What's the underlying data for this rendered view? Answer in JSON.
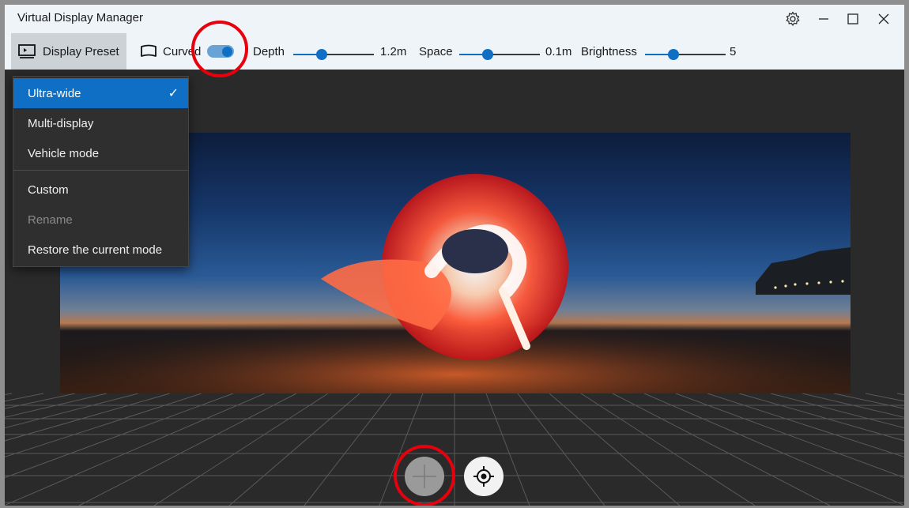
{
  "window": {
    "title": "Virtual Display Manager"
  },
  "titlebar": {
    "buttons": [
      {
        "icon": "gear-icon"
      },
      {
        "icon": "minimize-icon"
      },
      {
        "icon": "maximize-icon"
      },
      {
        "icon": "close-icon"
      }
    ]
  },
  "toolbar": {
    "preset_label": "Display Preset",
    "curved_label": "Curved",
    "curved_on": true,
    "depth_label": "Depth",
    "depth_value": "1.2m",
    "depth_level": 0.35,
    "space_label": "Space",
    "space_value": "0.1m",
    "space_level": 0.35,
    "brightness_label": "Brightness",
    "brightness_value": "5",
    "brightness_level": 0.35
  },
  "menu": {
    "items": [
      {
        "label": "Ultra-wide",
        "selected": true,
        "check": "✓"
      },
      {
        "label": "Multi-display"
      },
      {
        "label": "Vehicle mode"
      },
      {
        "label": "Custom"
      },
      {
        "label": "Rename",
        "disabled": true
      },
      {
        "label": "Restore the current mode"
      }
    ]
  },
  "bottom_buttons": [
    {
      "icon": "add-icon"
    },
    {
      "icon": "crosshair-icon"
    }
  ],
  "colors": {
    "accent": "#0e6fc4",
    "highlight_ring": "#e8000d",
    "toolbar_bg": "#eff4f9"
  }
}
